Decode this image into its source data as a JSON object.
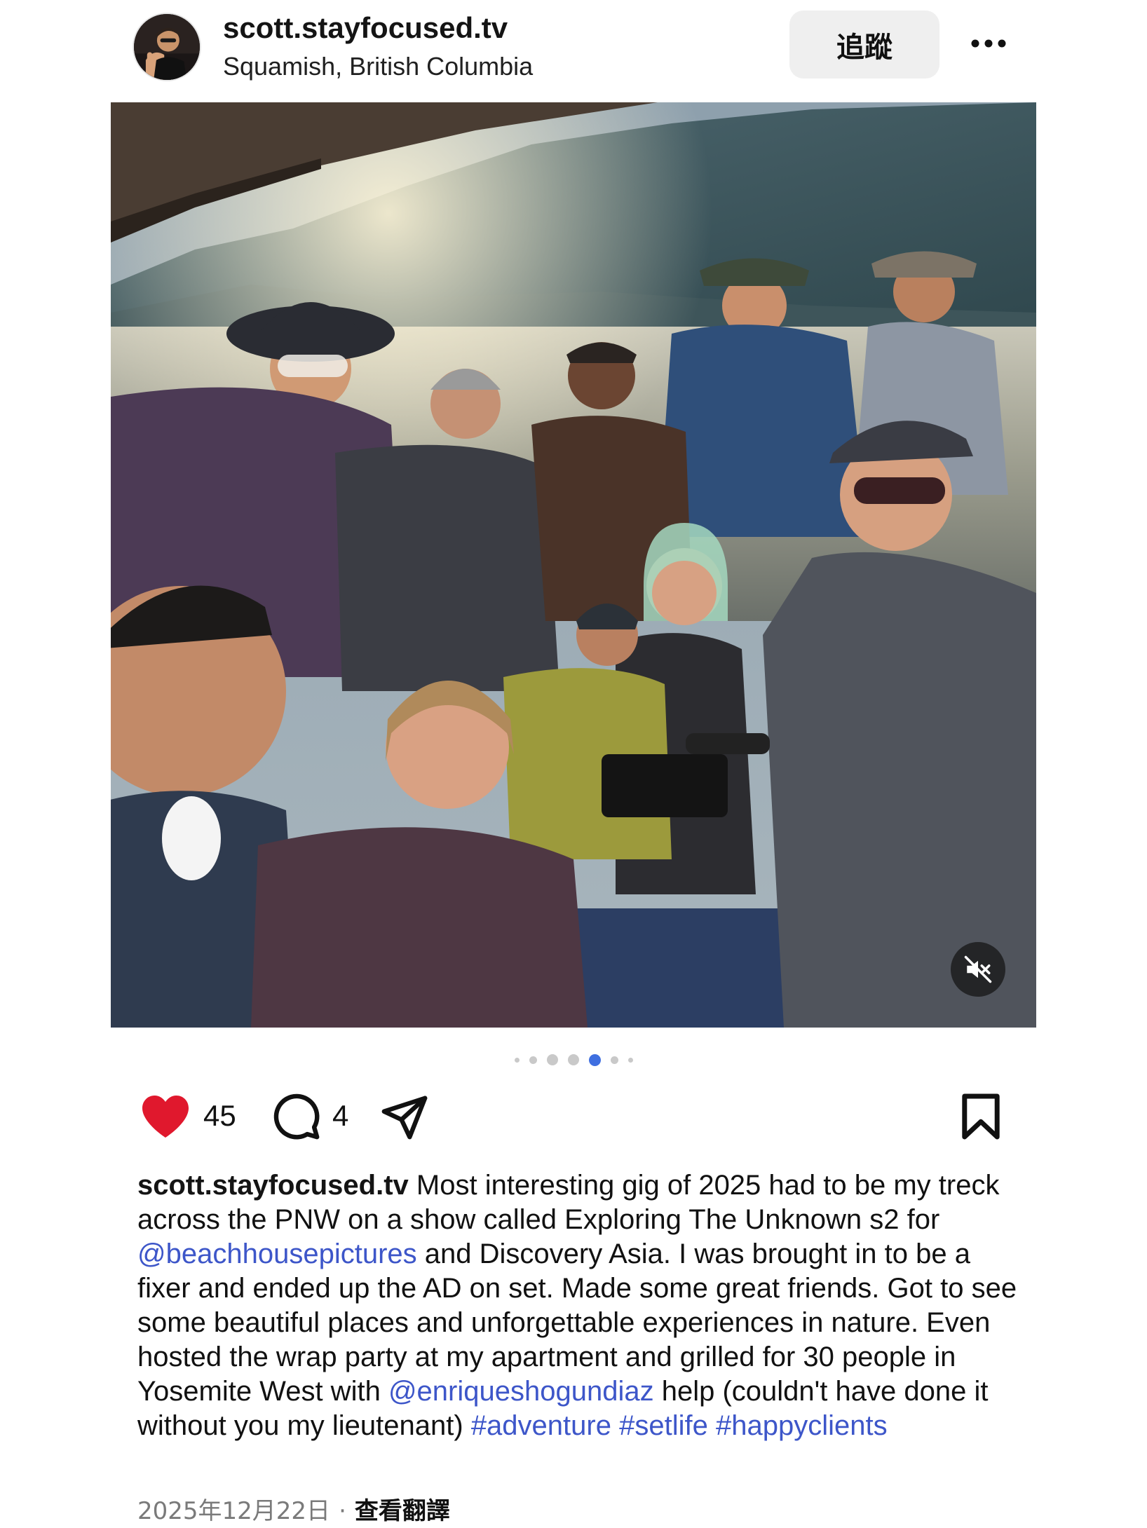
{
  "header": {
    "username": "scott.stayfocused.tv",
    "location": "Squamish, British Columbia",
    "follow_label": "追蹤",
    "more_icon": "more-horizontal-icon"
  },
  "media": {
    "description_icon": "photo",
    "mute_icon": "speaker-muted-icon",
    "carousel": {
      "count": 7,
      "active_index": 4
    }
  },
  "actions": {
    "like_count": "45",
    "comment_count": "4",
    "liked": true,
    "like_color": "#e0182d",
    "icons": [
      "heart-icon",
      "comment-icon",
      "send-icon",
      "bookmark-icon"
    ]
  },
  "caption": {
    "username": "scott.stayfocused.tv",
    "text_1": " Most interesting gig of 2025 had to be my treck across the PNW on a show called Exploring The Unknown s2 for ",
    "mention_1": "@beachhousepictures",
    "text_2": " and Discovery Asia. I was brought in to be a fixer and ended up the AD on set. Made some great friends. Got to see some beautiful places and unforgettable experiences in nature. Even hosted the wrap party at my apartment and grilled for 30 people in Yosemite West with ",
    "mention_2": "@enriqueshogundiaz",
    "text_3": "  help (couldn't have done it without you my lieutenant) ",
    "hashtag_1": "#adventure",
    "hashtag_2": "#setlife",
    "hashtag_3": "#happyclients",
    "link_color": "#3d56c9"
  },
  "footer": {
    "date": "2025年12月22日",
    "separator": "·",
    "translate_label": "查看翻譯"
  }
}
